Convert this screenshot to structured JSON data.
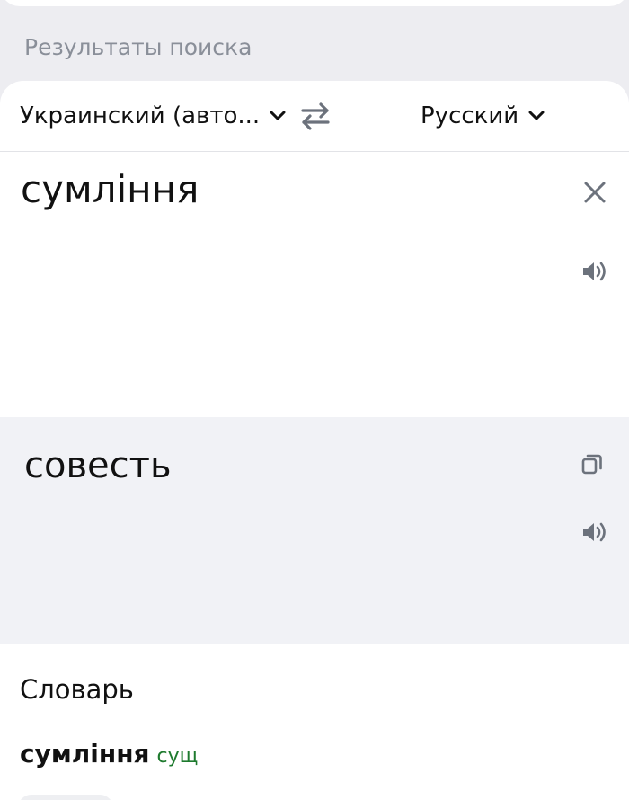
{
  "section": {
    "title": "Результаты поиска"
  },
  "languages": {
    "source": "Украинский (авто...",
    "target": "Русский"
  },
  "source": {
    "text": "сумління"
  },
  "translation": {
    "text": "совесть"
  },
  "dictionary": {
    "title": "Словарь",
    "entry": {
      "word": "сумління",
      "part_of_speech": "сущ"
    }
  },
  "icons": {
    "swap": "swap-arrows-icon",
    "clear": "close-icon",
    "speak": "speaker-icon",
    "copy": "copy-icon",
    "dropdown": "chevron-down-icon"
  },
  "colors": {
    "page_bg": "#ededf1",
    "muted_text": "#8a8f99",
    "icon_gray": "#6c727c",
    "translation_bg": "#f1f2f6",
    "pos_green": "#1e7a2e"
  }
}
